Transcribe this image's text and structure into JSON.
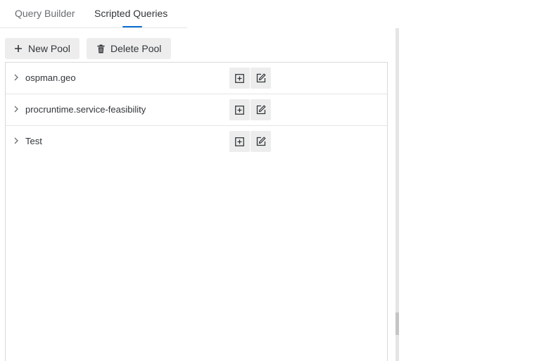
{
  "tabs": [
    {
      "label": "Query Builder",
      "selected": false
    },
    {
      "label": "Scripted Queries",
      "selected": true
    }
  ],
  "toolbar": {
    "new_pool_label": "New Pool",
    "delete_pool_label": "Delete Pool",
    "new_pool_icon": "plus-icon",
    "delete_pool_icon": "trash-icon"
  },
  "pools": [
    {
      "name": "ospman.geo",
      "expanded": false
    },
    {
      "name": "procruntime.service-feasibility",
      "expanded": false
    },
    {
      "name": "Test",
      "expanded": false
    }
  ],
  "row_actions": [
    "add-box-icon",
    "edit-icon"
  ],
  "colors": {
    "accent": "#0a6ed1",
    "button_bg": "#ededed",
    "text": "#32363a",
    "muted_text": "#6a6d70"
  }
}
